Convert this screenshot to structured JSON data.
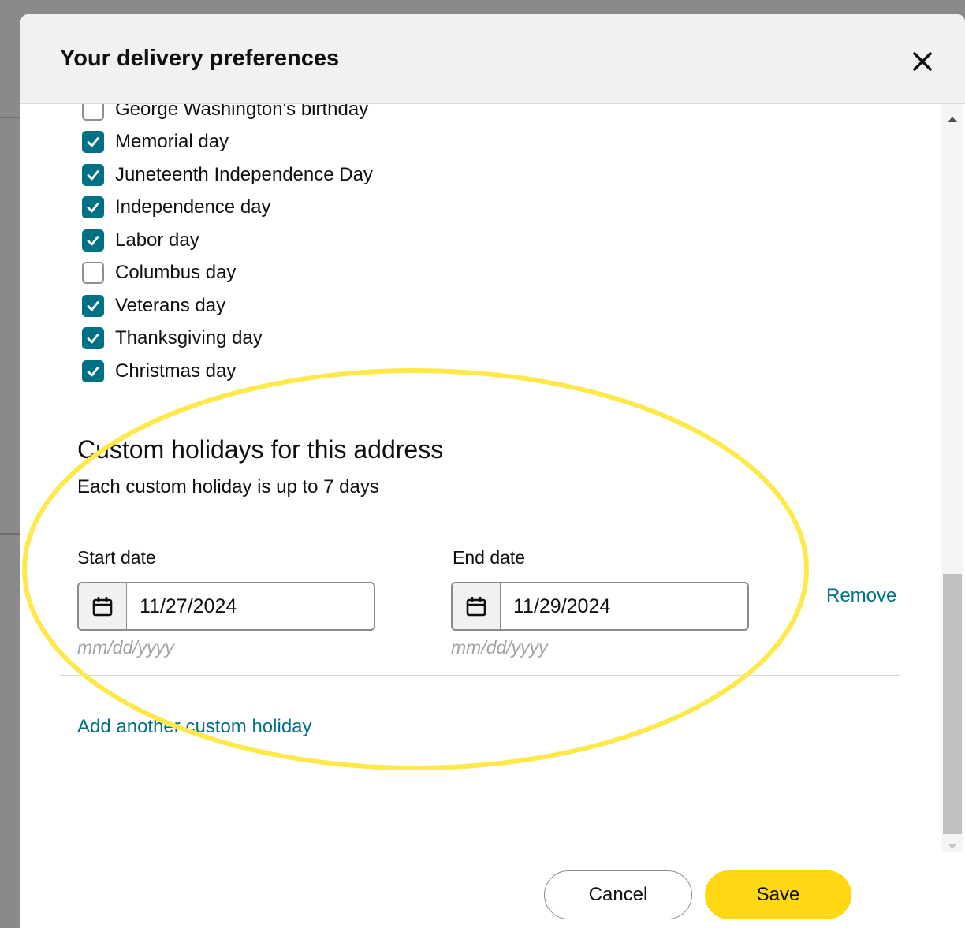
{
  "modal": {
    "title": "Your delivery preferences"
  },
  "holidays": [
    {
      "label": "George Washington's birthday",
      "checked": false
    },
    {
      "label": "Memorial day",
      "checked": true
    },
    {
      "label": "Juneteenth Independence Day",
      "checked": true
    },
    {
      "label": "Independence day",
      "checked": true
    },
    {
      "label": "Labor day",
      "checked": true
    },
    {
      "label": "Columbus day",
      "checked": false
    },
    {
      "label": "Veterans day",
      "checked": true
    },
    {
      "label": "Thanksgiving day",
      "checked": true
    },
    {
      "label": "Christmas day",
      "checked": true
    }
  ],
  "custom": {
    "title": "Custom holidays for this address",
    "subtitle": "Each custom holiday is up to 7 days",
    "start_label": "Start date",
    "start_value": "11/27/2024",
    "start_hint": "mm/dd/yyyy",
    "end_label": "End date",
    "end_value": "11/29/2024",
    "end_hint": "mm/dd/yyyy",
    "remove_label": "Remove",
    "add_label": "Add another custom holiday"
  },
  "footer": {
    "cancel_label": "Cancel",
    "save_label": "Save"
  },
  "colors": {
    "checkbox_checked": "#007185",
    "link": "#007185",
    "save_button": "#ffd814",
    "highlight_ellipse": "#ffe94a"
  }
}
